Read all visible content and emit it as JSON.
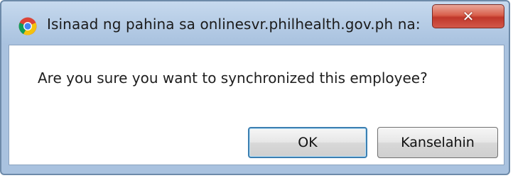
{
  "dialog": {
    "title": "Isinaad ng pahina sa onlinesvr.philhealth.gov.ph na:",
    "icon": "chrome-browser-icon",
    "close_icon": "close-icon",
    "message": "Are you sure you want to synchronized this employee?",
    "ok_label": "OK",
    "cancel_label": "Kanselahin"
  },
  "colors": {
    "titlebar": "#b7cde6",
    "close_button": "#c7412f",
    "ok_border": "#3c7fb1"
  }
}
